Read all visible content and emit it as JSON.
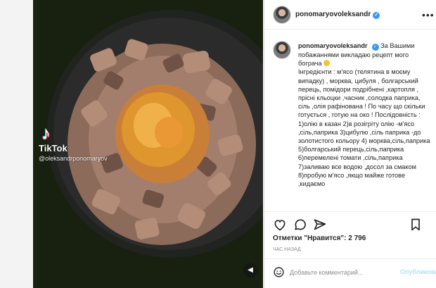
{
  "post": {
    "username": "ponomaryovoleksandr",
    "caption": "За Вашими побажаннями викладаю рецепт мого бограча",
    "body": "Інгредієнти : м'ясо (телятина в моєму випадку) , морква, цибуля , болгарський перець, помідори подрібнені ,картопля , прісні кльоцки ,часник ,солодка паприка, сіль ,олія рафінована ! По часу що скільки готується , готую на око ! Послідовність : 1)олію в казан 2)в розігріту олію -м'ясо ,сіль,паприка 3)цибулю ,сіль паприка -до золотистого кольору 4) морква,сіль,паприка 5)болгарський перець,сіль,паприка 6)перемелені томати ,сіль,паприка 7)заливаю все водою ,досол за смаком 8)пробую м'ясо ,якщо майже готове ,кидаємо",
    "likes": "Отметки \"Нравится\": 2 796",
    "time": "ЧАС НАЗАД"
  },
  "video": {
    "brand": "TikTok",
    "handle": "@oleksandrponomaryov"
  },
  "comment_box": {
    "placeholder": "Добавьте комментарий...",
    "publish_label": "Опубликовать"
  },
  "colors": {
    "accent": "#3897f0",
    "publish_disabled": "#b2dffc",
    "text": "#262626",
    "muted": "#8e8e8e"
  },
  "icons": {
    "like": "heart-icon",
    "comment": "comment-icon",
    "share": "share-icon",
    "save": "bookmark-icon",
    "more": "more-icon",
    "verified": "verified-icon",
    "emoji": "smile-icon",
    "sound": "sound-icon",
    "tiktok": "tiktok-logo-icon"
  }
}
